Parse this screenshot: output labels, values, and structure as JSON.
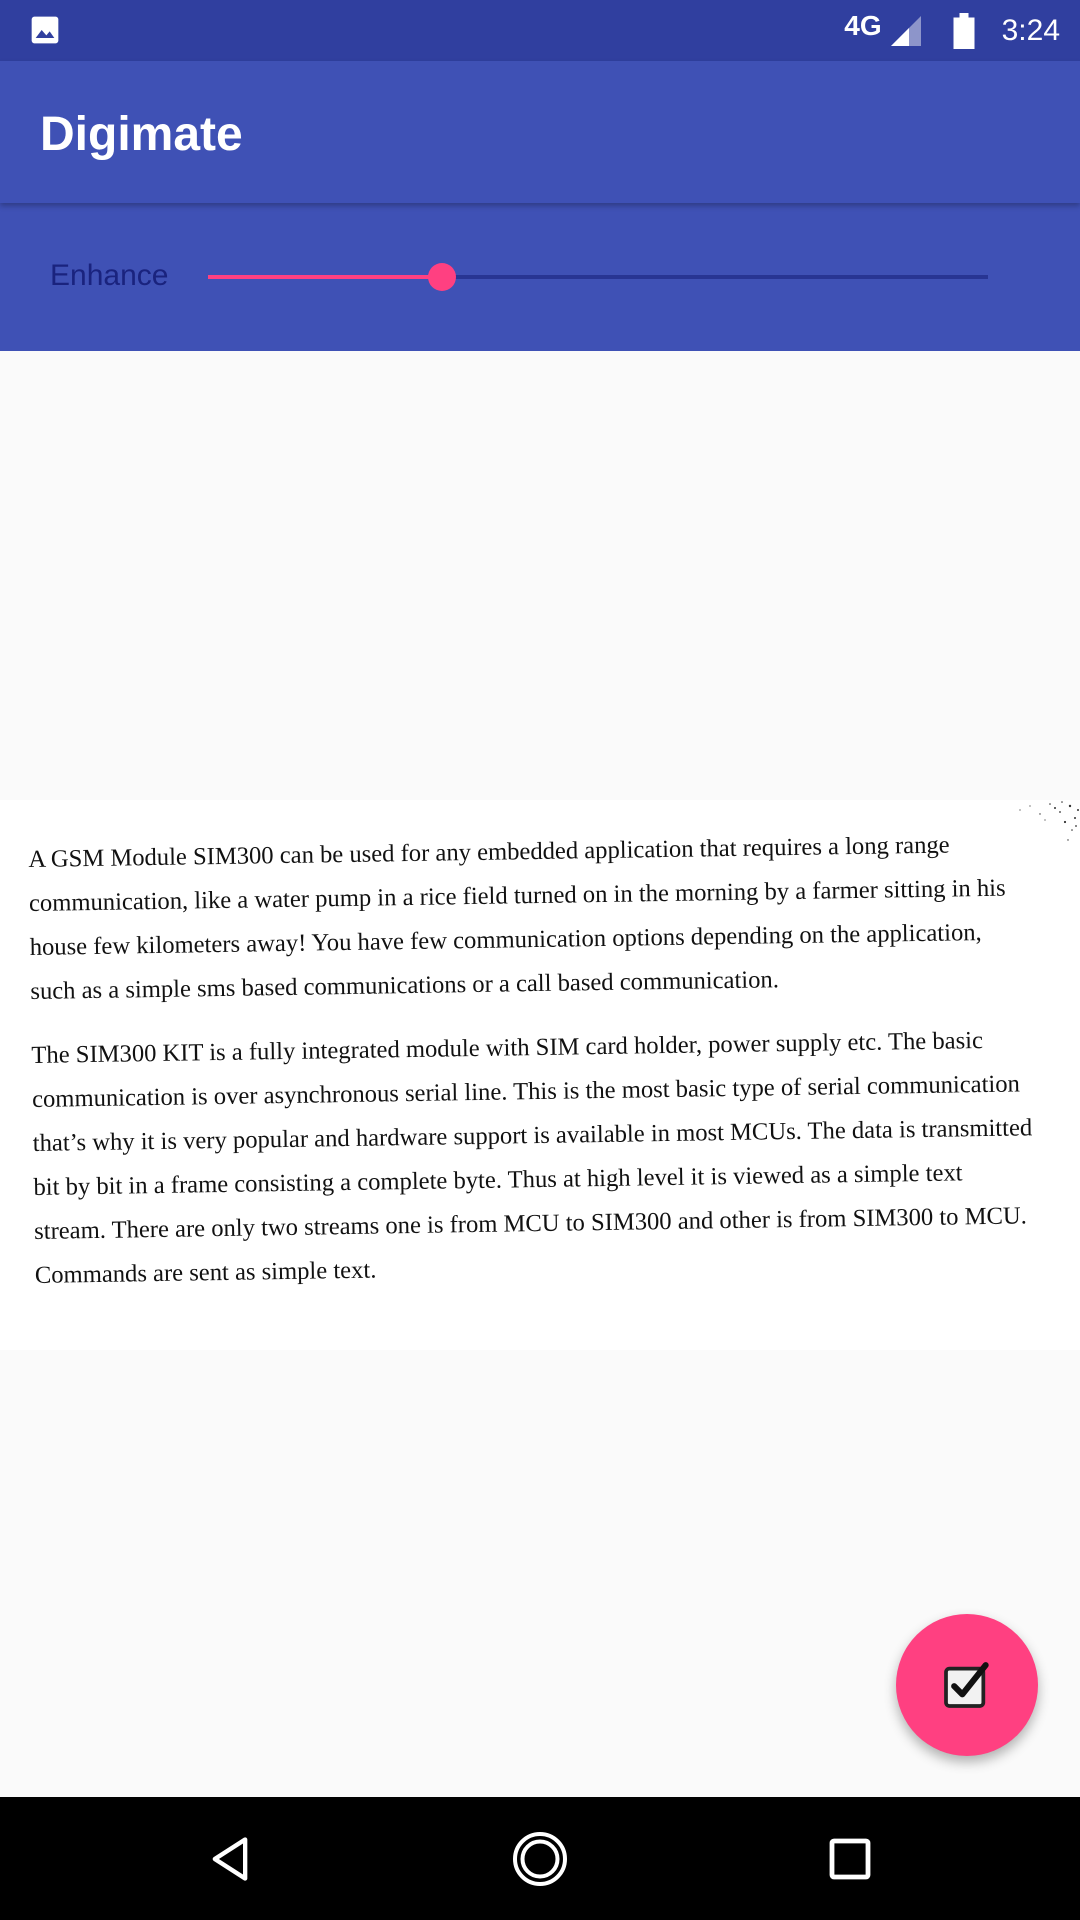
{
  "status_bar": {
    "network": "4G",
    "time": "3:24",
    "icons": [
      "image-icon",
      "signal-icon",
      "battery-icon"
    ]
  },
  "app_bar": {
    "title": "Digimate"
  },
  "enhance": {
    "label": "Enhance",
    "value_fraction": 0.3
  },
  "document": {
    "paragraphs": [
      "A GSM Module SIM300 can be used for any embedded application that requires a long range communication, like a water pump in a rice field turned on in the morning by a farmer sitting in his house few kilometers away! You have few communication options depending on the application, such as a simple sms based communications or a call based communication.",
      "The SIM300 KIT is a fully integrated module with SIM card holder, power supply etc. The basic communication is over asynchronous serial line. This is the most basic type of serial communication that’s why it is very popular and hardware support is available in most MCUs. The data is transmitted bit by bit in a frame consisting a complete byte. Thus at high level it is viewed as a simple text stream. There are only two streams one is from MCU to SIM300 and other is from SIM300 to MCU. Commands are sent as simple text."
    ]
  },
  "fab": {
    "icon": "checkbox-checked-icon"
  },
  "nav_bar": {
    "icons": [
      "back-icon",
      "home-icon",
      "recents-icon"
    ]
  },
  "colors": {
    "status_bar": "#303f9f",
    "primary": "#3f51b5",
    "accent": "#ff4081",
    "background": "#fafafa"
  }
}
